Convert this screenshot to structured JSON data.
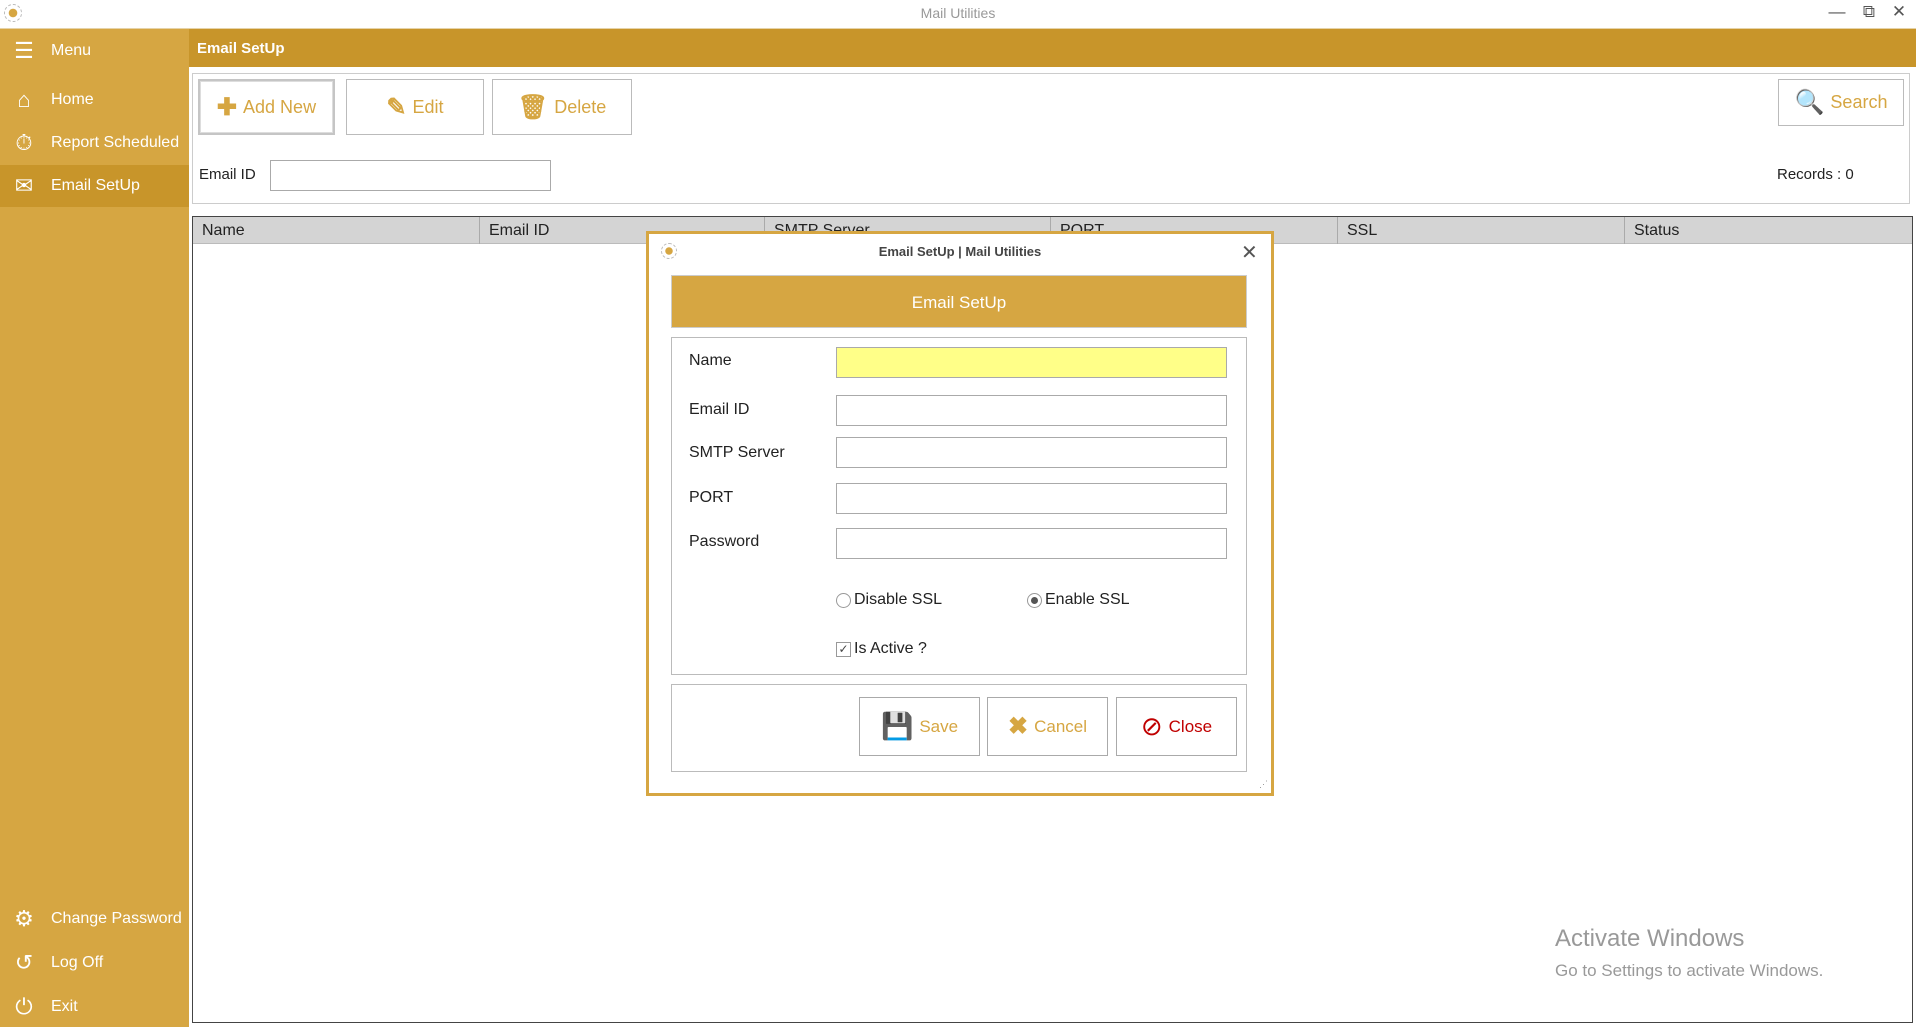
{
  "window": {
    "title": "Mail Utilities",
    "minimize_icon": "minimize-icon",
    "restore_icon": "restore-icon",
    "close_icon": "close-icon"
  },
  "sidebar": {
    "items": [
      {
        "label": "Menu",
        "icon": "hamburger-icon"
      },
      {
        "label": "Home",
        "icon": "home-icon"
      },
      {
        "label": "Report Scheduled",
        "icon": "clock-icon"
      },
      {
        "label": "Email SetUp",
        "icon": "envelope-icon",
        "selected": true
      },
      {
        "label": "Change Password",
        "icon": "gears-icon"
      },
      {
        "label": "Log Off",
        "icon": "undo-icon"
      },
      {
        "label": "Exit",
        "icon": "power-icon"
      }
    ]
  },
  "header": {
    "title": "Email SetUp"
  },
  "toolbar": {
    "add_label": "Add New",
    "edit_label": "Edit",
    "delete_label": "Delete",
    "search_label": "Search"
  },
  "filter": {
    "email_label": "Email ID",
    "email_value": "",
    "records": "Records : 0"
  },
  "grid": {
    "columns": [
      "Name",
      "Email ID",
      "SMTP Server",
      "PORT",
      "SSL",
      "Status"
    ],
    "rows": []
  },
  "dialog": {
    "title": "Email SetUp | Mail Utilities",
    "banner": "Email SetUp",
    "fields": [
      {
        "label": "Name",
        "value": ""
      },
      {
        "label": "Email ID",
        "value": ""
      },
      {
        "label": "SMTP Server",
        "value": ""
      },
      {
        "label": "PORT",
        "value": ""
      },
      {
        "label": "Password",
        "value": ""
      }
    ],
    "ssl_options": [
      {
        "label": "Disable SSL",
        "checked": false
      },
      {
        "label": "Enable SSL",
        "checked": true
      }
    ],
    "is_active": {
      "label": "Is Active ?",
      "checked": true
    },
    "save_label": "Save",
    "cancel_label": "Cancel",
    "close_label": "Close"
  },
  "watermark": {
    "line1": "Activate Windows",
    "line2": "Go to Settings to activate Windows."
  },
  "colors": {
    "sidebar": "#d6a642",
    "accent": "#c8952a",
    "focus_field": "#ffff88",
    "close_red": "#c00000"
  }
}
